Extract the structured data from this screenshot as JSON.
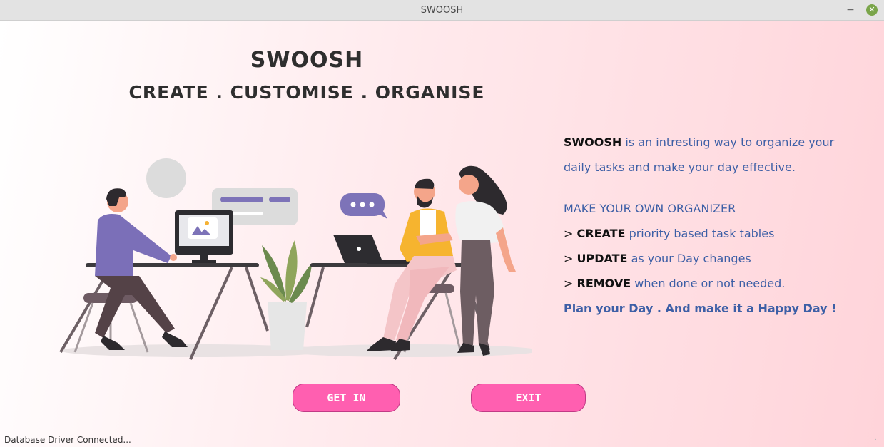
{
  "window": {
    "title": "SWOOSH",
    "minimize_label": "−",
    "close_label": "✕"
  },
  "header": {
    "app_name": "SWOOSH",
    "tagline": "CREATE . CUSTOMISE . ORGANISE"
  },
  "description": {
    "intro_brand": "SWOOSH",
    "intro_rest": " is an intresting way to organize your",
    "intro_line2": "daily tasks and make your day effective.",
    "heading": "MAKE YOUR OWN ORGANIZER",
    "features": [
      {
        "prefix": "> ",
        "keyword": "CREATE",
        "text": " priority based task tables"
      },
      {
        "prefix": "> ",
        "keyword": "UPDATE",
        "text": " as your Day changes"
      },
      {
        "prefix": "> ",
        "keyword": "REMOVE",
        "text": " when done or not needed."
      }
    ],
    "closing": "Plan your Day . And make it a Happy Day !"
  },
  "buttons": {
    "get_in": "GET IN",
    "exit": "EXIT"
  },
  "status": {
    "text": "Database Driver Connected..."
  },
  "colors": {
    "accent": "#ff5fb0",
    "text_blue": "#3d5fa6",
    "background_pink": "#ffd4da"
  },
  "illustration": {
    "icon": "office-workers-illustration"
  }
}
